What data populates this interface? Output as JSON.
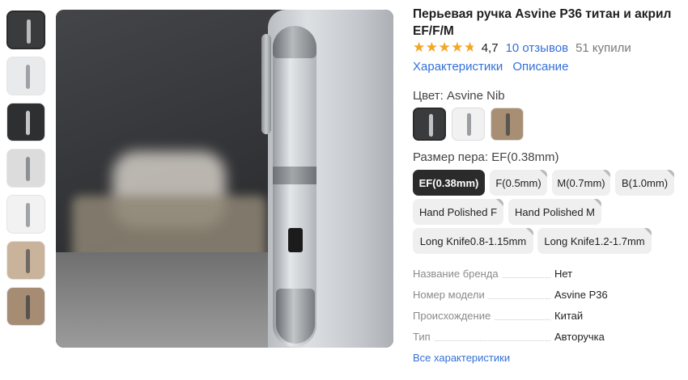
{
  "thumbnails": [
    {
      "bg": "#3a3b3d",
      "pen": "#b8bcc0",
      "selected": true
    },
    {
      "bg": "#e9eaeb",
      "pen": "#9ea2a6",
      "selected": false
    },
    {
      "bg": "#2e2f31",
      "pen": "#c3c6c9",
      "selected": false
    },
    {
      "bg": "#dcdcdc",
      "pen": "#8d9094",
      "selected": false
    },
    {
      "bg": "#f2f2f2",
      "pen": "#a0a4a8",
      "selected": false
    },
    {
      "bg": "#c9b39a",
      "pen": "#6f6a66",
      "selected": false
    },
    {
      "bg": "#a58c73",
      "pen": "#57534f",
      "selected": false
    }
  ],
  "product": {
    "title": "Перьевая ручка Asvine P36 титан и акрил EF/F/M",
    "stars": "★★★★★",
    "rating_value": 4.7,
    "rating": "4,7",
    "reviews": "10 отзывов",
    "bought": "51 купили"
  },
  "links": {
    "specs": "Характеристики",
    "description": "Описание"
  },
  "color": {
    "label": "Цвет: Asvine Nib",
    "swatches": [
      {
        "bg": "#3a3b3d",
        "pen": "#c0c3c6",
        "selected": true
      },
      {
        "bg": "#f1f1f1",
        "pen": "#9a9ea2",
        "selected": false
      },
      {
        "bg": "#a88e72",
        "pen": "#5a5652",
        "selected": false
      }
    ]
  },
  "nib": {
    "label": "Размер пера: EF(0.38mm)",
    "options": [
      {
        "label": "EF(0.38mm)",
        "selected": true
      },
      {
        "label": "F(0.5mm)",
        "selected": false
      },
      {
        "label": "M(0.7mm)",
        "selected": false
      },
      {
        "label": "B(1.0mm)",
        "selected": false
      },
      {
        "label": "Hand Polished F",
        "selected": false
      },
      {
        "label": "Hand Polished M",
        "selected": false
      },
      {
        "label": "Long Knife0.8-1.15mm",
        "selected": false
      },
      {
        "label": "Long Knife1.2-1.7mm",
        "selected": false
      }
    ]
  },
  "specs": [
    {
      "key": "Название бренда",
      "value": "Нет"
    },
    {
      "key": "Номер модели",
      "value": "Asvine P36"
    },
    {
      "key": "Происхождение",
      "value": "Китай"
    },
    {
      "key": "Тип",
      "value": "Авторучка"
    }
  ],
  "all_specs": "Все характеристики",
  "colors": {
    "link": "#3470d8",
    "star": "#f5a623",
    "selected_chip": "#2b2b2b",
    "chip_bg": "#efefef"
  }
}
